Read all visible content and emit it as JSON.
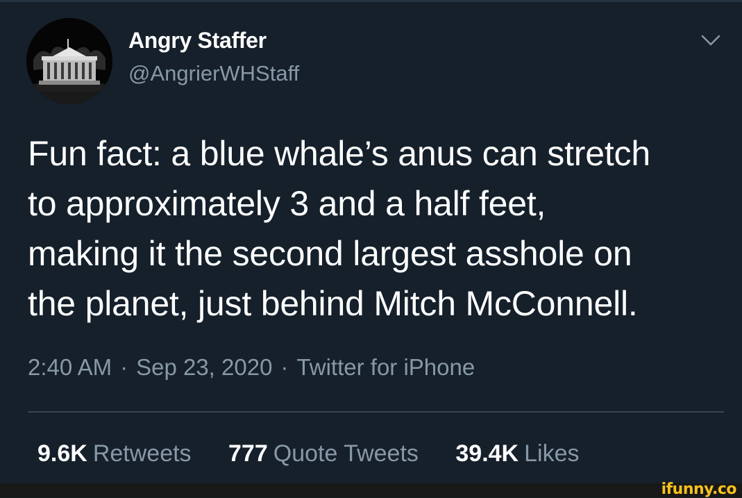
{
  "tweet": {
    "author": {
      "name": "Angry Staffer",
      "handle": "@AngrierWHStaff",
      "avatar_icon": "white-house-icon"
    },
    "menu_icon": "chevron-down-icon",
    "text": "Fun fact: a blue whale’s anus can stretch\nto approximately 3 and a half feet,\nmaking it the second largest asshole on\nthe planet, just behind Mitch McConnell.",
    "time": "2:40 AM",
    "date": "Sep 23, 2020",
    "source": "Twitter for iPhone",
    "separator": "·",
    "stats": {
      "retweets": {
        "value": "9.6K",
        "label": "Retweets"
      },
      "quote_tweets": {
        "value": "777",
        "label": "Quote Tweets"
      },
      "likes": {
        "value": "39.4K",
        "label": "Likes"
      }
    }
  },
  "watermark": "ifunny.co",
  "colors": {
    "background": "#15202b",
    "text_primary": "#ffffff",
    "text_secondary": "#8899a6",
    "divider": "#38444d",
    "watermark": "#f6c21c"
  }
}
